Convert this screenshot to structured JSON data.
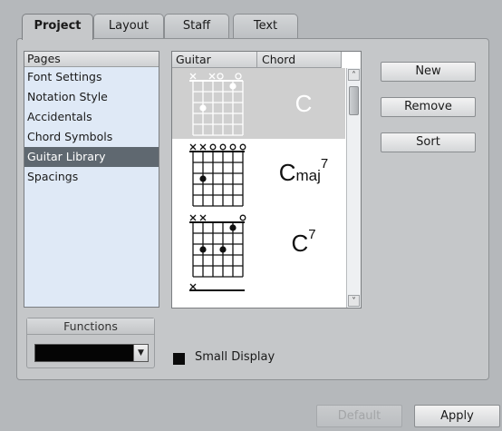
{
  "tabs": [
    "Project",
    "Layout",
    "Staff",
    "Text"
  ],
  "pages": {
    "header": "Pages",
    "items": [
      "Font Settings",
      "Notation Style",
      "Accidentals",
      "Chord Symbols",
      "Guitar Library",
      "Spacings"
    ],
    "selected": "Guitar Library"
  },
  "library": {
    "headers": {
      "guitar": "Guitar",
      "chord": "Chord"
    },
    "chords": [
      {
        "root": "C",
        "suffix": "",
        "superscript": "",
        "markers": "x x o o",
        "selected": true
      },
      {
        "root": "C",
        "suffix": "maj",
        "superscript": "7",
        "markers": "x x o o o o",
        "selected": false
      },
      {
        "root": "C",
        "suffix": "",
        "superscript": "7",
        "markers": "x x o",
        "selected": false
      }
    ]
  },
  "buttons": {
    "new": "New",
    "remove": "Remove",
    "sort": "Sort"
  },
  "functions": {
    "title": "Functions",
    "value": ""
  },
  "small_display": {
    "label": "Small Display",
    "checked": false
  },
  "footer": {
    "default": "Default",
    "apply": "Apply"
  }
}
